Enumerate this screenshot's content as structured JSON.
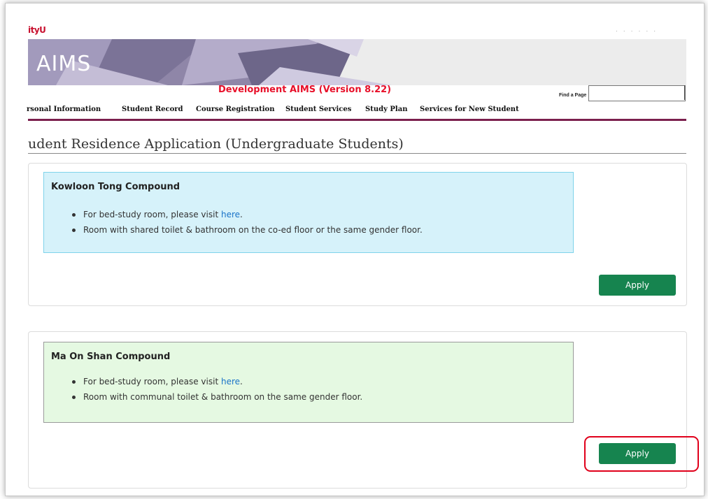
{
  "header": {
    "logo_text": "ityU",
    "app_title": "AIMS",
    "dev_title": "Development AIMS (Version 8.22)",
    "find_label": "Find a Page",
    "find_value": "",
    "top_right_text": "· · · · · ·"
  },
  "nav": {
    "items": [
      {
        "label": "rsonal Information"
      },
      {
        "label": "Student Record"
      },
      {
        "label": "Course Registration"
      },
      {
        "label": "Student Services"
      },
      {
        "label": "Study Plan"
      },
      {
        "label": "Services for New Student"
      }
    ]
  },
  "page": {
    "title": "udent Residence Application (Undergraduate Students)"
  },
  "compounds": [
    {
      "name": "Kowloon Tong Compound",
      "bullet1_prefix": "For bed-study room, please visit ",
      "bullet1_link": "here",
      "bullet1_suffix": ".",
      "bullet2": "Room with shared toilet & bathroom on the co-ed floor or the same gender floor.",
      "apply_label": "Apply",
      "bg_color": "#d6f2fa"
    },
    {
      "name": "Ma On Shan Compound",
      "bullet1_prefix": "For bed-study room, please visit ",
      "bullet1_link": "here",
      "bullet1_suffix": ".",
      "bullet2": "Room with communal toilet & bathroom on the same gender floor.",
      "apply_label": "Apply",
      "bg_color": "#e5f9e2"
    }
  ],
  "colors": {
    "accent": "#16844f",
    "dev_title": "#e8102a",
    "nav_underline": "#7b1f4d",
    "highlight": "#e0001b",
    "link": "#1a73c8"
  }
}
